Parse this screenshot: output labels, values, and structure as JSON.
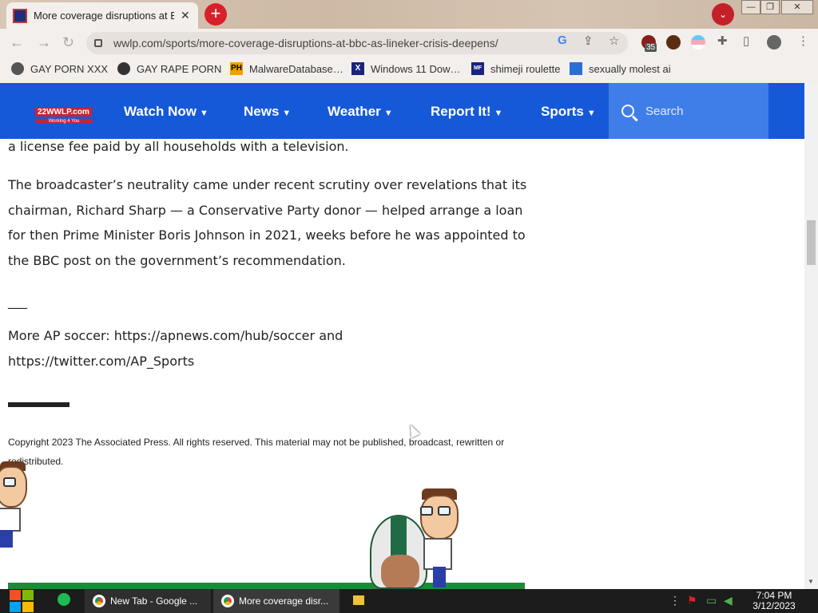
{
  "browser": {
    "tab_title": "More coverage disruptions at B",
    "close_glyph": "✕",
    "new_tab_glyph": "+",
    "tab_search_glyph": "⌄",
    "url": "wwlp.com/sports/more-coverage-disruptions-at-bbc-as-lineker-crisis-deepens/",
    "extension_badge": "35",
    "window_controls": {
      "minimize": "—",
      "restore": "❐",
      "close": "✕"
    },
    "bookmarks": [
      {
        "label": "GAY PORN XXX",
        "icon": "bookmark-icon"
      },
      {
        "label": "GAY RAPE PORN",
        "icon": "globe-icon"
      },
      {
        "label": "MalwareDatabase…",
        "icon": "PH"
      },
      {
        "label": "Windows 11 Dow…",
        "icon": "X"
      },
      {
        "label": "shimeji roulette",
        "icon": "MF"
      },
      {
        "label": "sexually molest ai",
        "icon": "bookmark-icon"
      }
    ]
  },
  "site": {
    "logo_main": "22WWLP.com",
    "logo_sub": "Working 4 You",
    "nav": [
      {
        "label": "Watch Now",
        "caret": "▼"
      },
      {
        "label": "News",
        "caret": "▼"
      },
      {
        "label": "Weather",
        "caret": "▼"
      },
      {
        "label": "Report It!",
        "caret": "▼"
      },
      {
        "label": "Sports",
        "caret": "▼"
      }
    ],
    "search_placeholder": "Search"
  },
  "article": {
    "p1": "a license fee paid by all households with a television.",
    "p2": "The broadcaster’s neutrality came under recent scrutiny over revelations that its chairman, Richard Sharp — a Conservative Party donor — helped arrange a loan for then Prime Minister Boris Johnson in 2021, weeks before he was appointed to the BBC post on the government’s recommendation.",
    "separator": "___",
    "p3": "More AP soccer: https://apnews.com/hub/soccer and https://twitter.com/AP_Sports",
    "copyright": "Copyright 2023 The Associated Press. All rights reserved. This material may not be published, broadcast, rewritten or redistributed."
  },
  "taskbar": {
    "apps": [
      {
        "label": "New Tab - Google ..."
      },
      {
        "label": "More coverage disr..."
      }
    ],
    "time": "7:04 PM",
    "date": "3/12/2023"
  },
  "colors": {
    "site_nav": "#1559d8",
    "search_bg": "#3f7ee8",
    "newtab_button": "#d8202a",
    "taskbar": "#1c1c1c"
  }
}
